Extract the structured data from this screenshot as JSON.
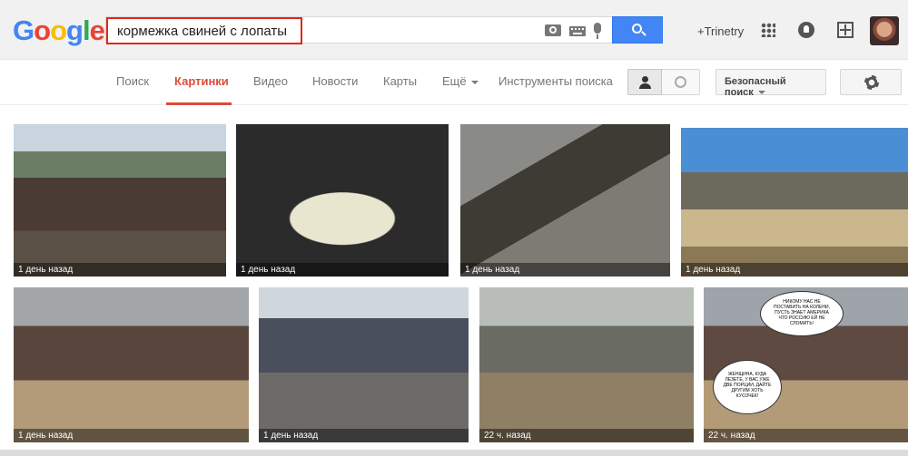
{
  "header": {
    "logo": [
      "G",
      "o",
      "o",
      "g",
      "l",
      "e"
    ],
    "search_query": "кормежка свиней с лопаты",
    "plus_user": "+Trinetry"
  },
  "tabs": [
    {
      "label": "Поиск"
    },
    {
      "label": "Картинки"
    },
    {
      "label": "Видео"
    },
    {
      "label": "Новости"
    },
    {
      "label": "Карты"
    },
    {
      "label": "Ещё"
    },
    {
      "label": "Инструменты поиска"
    }
  ],
  "toolbar": {
    "safe_search": "Безопасный поиск"
  },
  "results": [
    {
      "caption": "1 день назад"
    },
    {
      "caption": "1 день назад"
    },
    {
      "caption": "1 день назад"
    },
    {
      "caption": "1 день назад"
    },
    {
      "caption": "1 день назад"
    },
    {
      "caption": "1 день назад"
    },
    {
      "caption": "22 ч. назад"
    },
    {
      "caption": "22 ч. назад"
    }
  ],
  "comic_text": [
    "НИКОМУ НАС НЕ ПОСТАВИТЬ НА КОЛЕНИ, ПУСТЬ ЗНАЕТ АМЕРИКА ЧТО РОССИЮ ЕЙ НЕ СЛОМИТЬ!",
    "ЖЕНЩИНА, КУДА ЛЕЗЕТЕ, У ВАС УЖЕ ДВЕ ПОРЦИИ, ДАЙТЕ ДРУГИМ ХОТЬ КУСОЧЕК!"
  ]
}
